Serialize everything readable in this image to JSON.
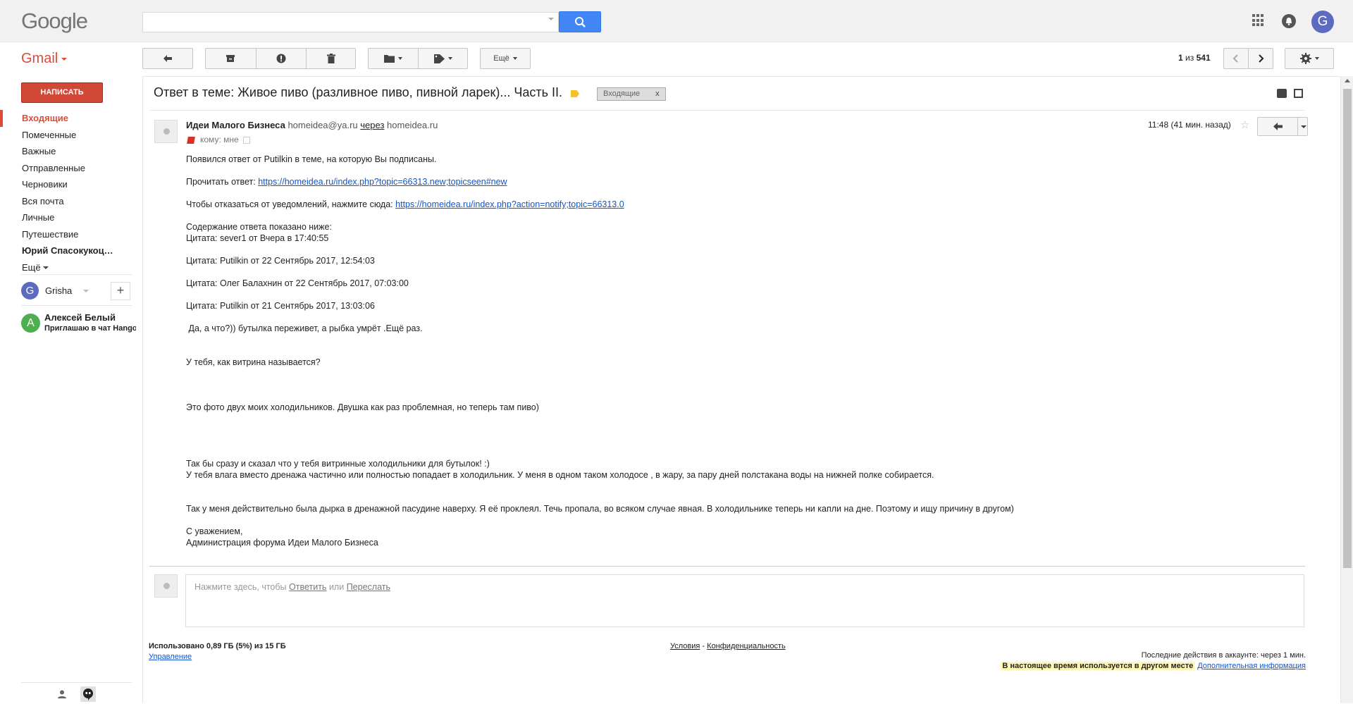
{
  "header": {
    "logo": "Google",
    "search_placeholder": "",
    "avatar_letter": "G"
  },
  "gmail": {
    "label": "Gmail"
  },
  "toolbar": {
    "more_label": "Ещё",
    "pager_current": "1",
    "pager_sep": "из",
    "pager_total": "541"
  },
  "nav": {
    "compose_label": "НАПИСАТЬ",
    "items": [
      {
        "label": "Входящие",
        "active": true
      },
      {
        "label": "Помеченные"
      },
      {
        "label": "Важные"
      },
      {
        "label": "Отправленные"
      },
      {
        "label": "Черновики"
      },
      {
        "label": "Вся почта"
      },
      {
        "label": "Личные"
      },
      {
        "label": "Путешествие"
      },
      {
        "label": "Юрий Спасокукоц…",
        "bold": true
      },
      {
        "label": "Ещё"
      }
    ],
    "hangouts_user": {
      "letter": "G",
      "name": "Grisha"
    },
    "contact": {
      "letter": "A",
      "name": "Алексей Белый",
      "status": "Приглашаю в чат Hangouts"
    }
  },
  "message": {
    "subject": "Ответ в теме: Живое пиво (разливное пиво, пивной ларек)... Часть II.",
    "label_chip": "Входящие",
    "sender_name": "Идеи Малого Бизнеса",
    "sender_email": "homeidea@ya.ru",
    "via_label": "через",
    "via_domain": "homeidea.ru",
    "to_label": "кому: мне",
    "time": "11:48 (41 мин. назад)",
    "body": {
      "line1": "Появился ответ от Putilkin в теме, на которую Вы подписаны.",
      "read_label": "Прочитать ответ:",
      "read_link": "https://homeidea.ru/index.php?topic=66313.new;topicseen#new",
      "unsub_label": "Чтобы отказаться от уведомлений, нажмите сюда:",
      "unsub_link": "https://homeidea.ru/index.php?action=notify;topic=66313.0",
      "content_intro": "Содержание ответа показано ниже:",
      "quote1": "Цитата: sever1 от Вчера в 17:40:55",
      "quote2": "Цитата: Putilkin от 22 Сентябрь 2017, 12:54:03",
      "quote3": "Цитата: Олег Балахнин от 22 Сентябрь 2017, 07:03:00",
      "quote4": "Цитата: Putilkin от 21 Сентябрь 2017, 13:03:06",
      "text1": " Да, а что?)) бутылка переживет, а рыбка умрёт .Ещё раз.",
      "text2": "У тебя, как витрина называется?",
      "text3": "Это фото двух моих холодильников. Двушка как раз проблемная, но теперь там пиво)",
      "text4": "Так бы сразу и сказал что у тебя витринные холодильники для бутылок! :)",
      "text5": "У тебя влага вместо дренажа частично или полностью попадает в холодильник. У меня в одном таком холодосе , в жару, за пару дней полстакана воды на нижней полке собирается.",
      "text6": "Так у меня действительно была дырка в дренажной пасудине наверху. Я её проклеял. Течь пропала, во всяком случае явная. В холодильнике теперь ни капли на дне. Поэтому и ищу причину в другом)",
      "regards": "С уважением,",
      "signature": "Администрация форума Идеи Малого Бизнеса"
    }
  },
  "reply_box": {
    "prefix": "Нажмите здесь, чтобы",
    "reply_link": "Ответить",
    "or": "или",
    "forward_link": "Переслать"
  },
  "footer": {
    "storage": "Использовано 0,89 ГБ (5%) из 15 ГБ",
    "manage": "Управление",
    "terms": "Условия",
    "dash": "-",
    "privacy": "Конфиденциальность",
    "activity": "Последние действия в аккаунте: через 1 мин.",
    "now_used": "В настоящее время используется в другом месте",
    "more_info": "Дополнительная информация"
  }
}
